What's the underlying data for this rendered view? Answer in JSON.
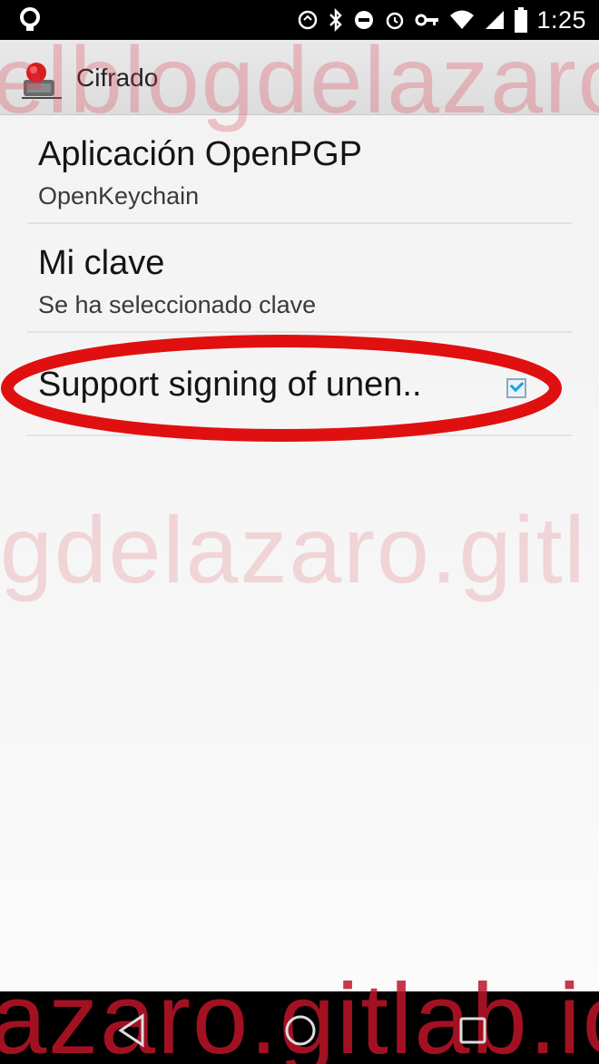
{
  "status_bar": {
    "time": "1:25",
    "icons": [
      "sync-icon",
      "bluetooth-icon",
      "do-not-disturb-icon",
      "alarm-icon",
      "vpn-key-icon",
      "wifi-icon",
      "signal-icon",
      "battery-icon"
    ]
  },
  "action_bar": {
    "title": "Cifrado",
    "icon": "app-icon"
  },
  "preferences": [
    {
      "title": "Aplicación OpenPGP",
      "summary": "OpenKeychain"
    },
    {
      "title": "Mi clave",
      "summary": "Se ha seleccionado clave"
    },
    {
      "title": "Support signing of unen..",
      "checked": true
    }
  ],
  "annotation_color": "#e01010",
  "watermark": {
    "top": "elblogdelazaro",
    "middle": "gdelazaro.gitl",
    "bottom": "azaro.gitlab.io"
  },
  "nav_bar": {
    "buttons": [
      "back-icon",
      "home-icon",
      "recents-icon"
    ]
  }
}
